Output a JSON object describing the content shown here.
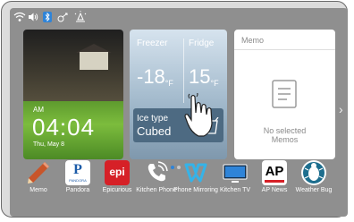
{
  "status": {
    "icons": [
      "wifi-icon",
      "volume-icon",
      "bluetooth-icon",
      "network-icon",
      "brightness-icon"
    ]
  },
  "clock": {
    "ampm": "AM",
    "time": "04:04",
    "date": "Thu, May 8"
  },
  "fridge": {
    "freezer_label": "Freezer",
    "freezer_temp": "-18",
    "fridge_label": "Fridge",
    "fridge_temp": "15",
    "unit": "°F",
    "ice_type_label": "Ice type",
    "ice_type_value": "Cubed"
  },
  "memo": {
    "title": "Memo",
    "empty_line1": "No selected",
    "empty_line2": "Memos"
  },
  "dock": [
    {
      "name": "Memo",
      "label": "Memo"
    },
    {
      "name": "Pandora",
      "label": "Pandora",
      "icon_text": "P",
      "sub_text": "PANDORA"
    },
    {
      "name": "Epicurious",
      "label": "Epicurious",
      "icon_text": "epi"
    },
    {
      "name": "Kitchen Phone",
      "label": "Kitchen Phone"
    },
    {
      "name": "Phone Mirroring",
      "label": "Phone Mirroring"
    },
    {
      "name": "Kitchen TV",
      "label": "Kitchen TV"
    },
    {
      "name": "AP News",
      "label": "AP News",
      "icon_text": "AP"
    },
    {
      "name": "Weather Bug",
      "label": "Weather Bug"
    }
  ],
  "colors": {
    "accent": "#2f84d8",
    "epi_red": "#d62027",
    "pandora_blue": "#1c5ba8"
  }
}
